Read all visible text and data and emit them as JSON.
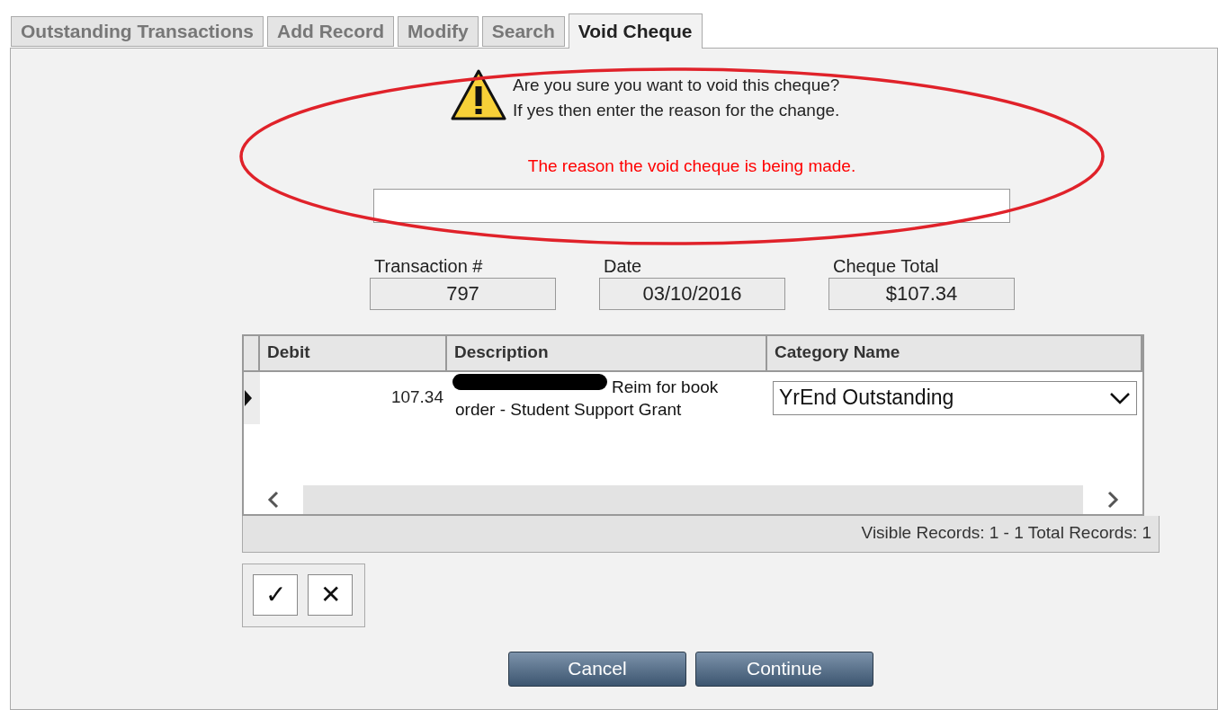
{
  "tabs": [
    {
      "label": "Outstanding Transactions",
      "selected": false
    },
    {
      "label": "Add Record",
      "selected": false
    },
    {
      "label": "Modify",
      "selected": false
    },
    {
      "label": "Search",
      "selected": false
    },
    {
      "label": "Void Cheque",
      "selected": true
    }
  ],
  "warning": {
    "lines": [
      "Are you sure you want to void this cheque?",
      "If yes then enter the reason for the change."
    ]
  },
  "reason": {
    "label": "The reason the void cheque is being made."
  },
  "summary": [
    {
      "label": "Transaction #",
      "value": "797"
    },
    {
      "label": "Date",
      "value": "03/10/2016"
    },
    {
      "label": "Cheque Total",
      "value": "$107.34"
    }
  ],
  "table": {
    "columns": [
      "Debit",
      "Description",
      "Category Name"
    ],
    "rows": [
      {
        "selected": true,
        "debit": "107.34",
        "description_redacted": true,
        "description": "Reim for book order - Student Support Grant",
        "category": "YrEnd Outstanding"
      }
    ],
    "status": "Visible Records: 1 - 1 Total Records: 1"
  },
  "row_buttons": [
    "✓",
    "✕"
  ],
  "buttons": [
    "Cancel",
    "Continue"
  ]
}
